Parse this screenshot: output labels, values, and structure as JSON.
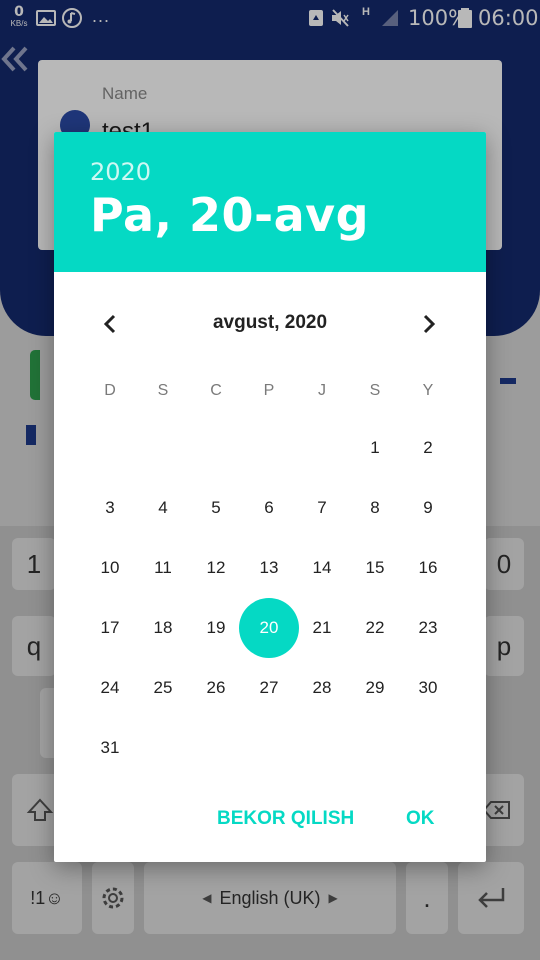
{
  "status_bar": {
    "speed_value": "0",
    "speed_unit": "KB/s",
    "more": "...",
    "network": "H",
    "battery": "100%",
    "time": "06:00"
  },
  "background": {
    "name_label": "Name",
    "name_value": "test1"
  },
  "keyboard": {
    "keys_visible": [
      "1",
      "0",
      "q",
      "p",
      "!1☺",
      "English (UK)",
      "."
    ],
    "language_label": "English (UK)"
  },
  "dialog": {
    "year": "2020",
    "selected_date_label": "Pa, 20-avg",
    "month_title": "avgust, 2020",
    "weekdays": [
      "D",
      "S",
      "C",
      "P",
      "J",
      "S",
      "Y"
    ],
    "first_weekday_index": 5,
    "days_in_month": 31,
    "selected_day": "20",
    "cancel_label": "BEKOR QILISH",
    "ok_label": "OK",
    "accent_color": "#05d9c4",
    "days": [
      "1",
      "2",
      "3",
      "4",
      "5",
      "6",
      "7",
      "8",
      "9",
      "10",
      "11",
      "12",
      "13",
      "14",
      "15",
      "16",
      "17",
      "18",
      "19",
      "20",
      "21",
      "22",
      "23",
      "24",
      "25",
      "26",
      "27",
      "28",
      "29",
      "30",
      "31"
    ]
  }
}
